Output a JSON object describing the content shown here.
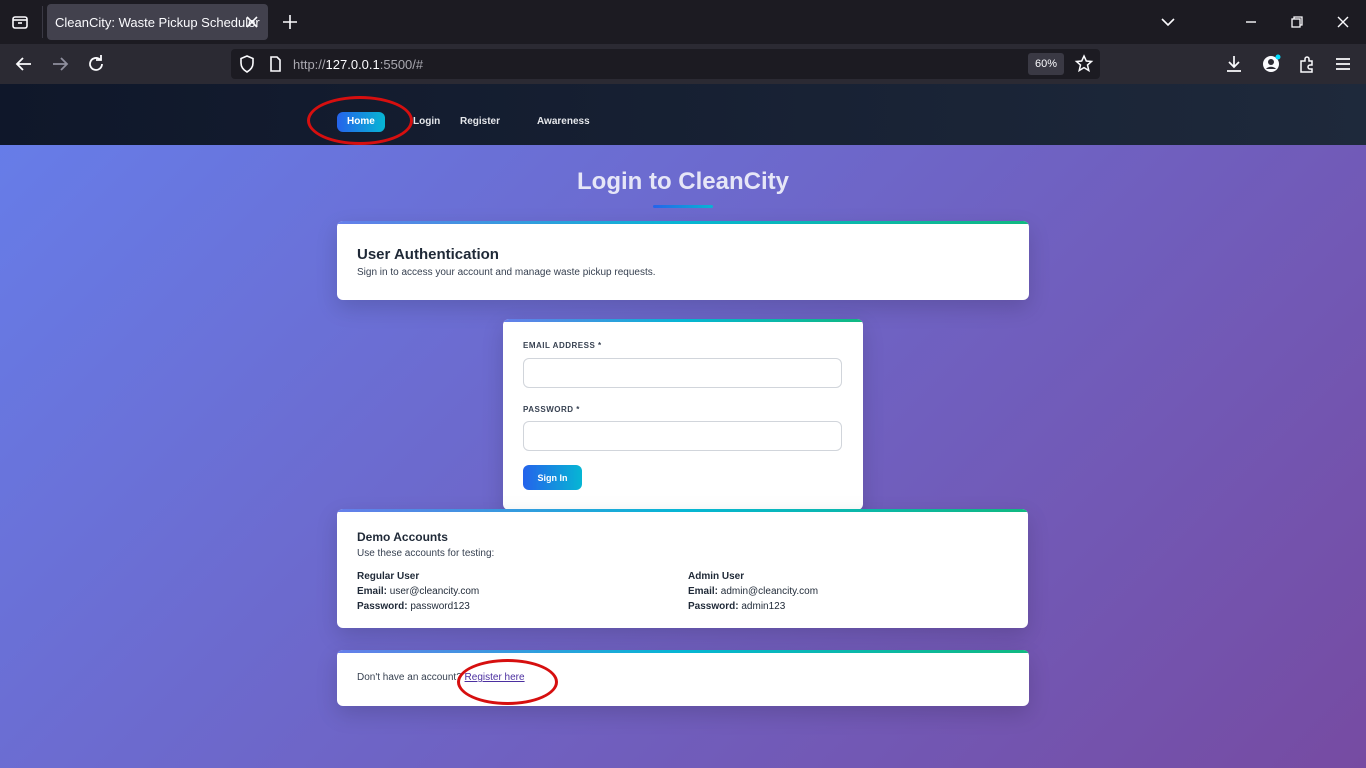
{
  "browser": {
    "tab_title": "CleanCity: Waste Pickup Scheduler",
    "url_prefix": "http://",
    "url_host": "127.0.0.1",
    "url_rest": ":5500/#",
    "zoom": "60%"
  },
  "site_nav": {
    "items": [
      {
        "label": "Home",
        "active": true
      },
      {
        "label": "Login"
      },
      {
        "label": "Register"
      },
      {
        "label": "Awareness"
      }
    ]
  },
  "page": {
    "title": "Login to CleanCity"
  },
  "auth_card": {
    "title": "User Authentication",
    "subtitle": "Sign in to access your account and manage waste pickup requests."
  },
  "login_form": {
    "email_label": "EMAIL ADDRESS *",
    "email_value": "",
    "password_label": "PASSWORD *",
    "password_value": "",
    "submit_label": "Sign In"
  },
  "demo": {
    "title": "Demo Accounts",
    "intro": "Use these accounts for testing:",
    "accounts": [
      {
        "role": "Regular User",
        "email_label": "Email:",
        "email": "user@cleancity.com",
        "password_label": "Password:",
        "password": "password123"
      },
      {
        "role": "Admin User",
        "email_label": "Email:",
        "email": "admin@cleancity.com",
        "password_label": "Password:",
        "password": "admin123"
      }
    ]
  },
  "register_prompt": {
    "text": "Don't have an account?",
    "link": "Register here"
  },
  "colors": {
    "annotation": "#d60f0f",
    "accent_gradient_start": "#2563eb",
    "accent_gradient_end": "#06b6d4"
  }
}
